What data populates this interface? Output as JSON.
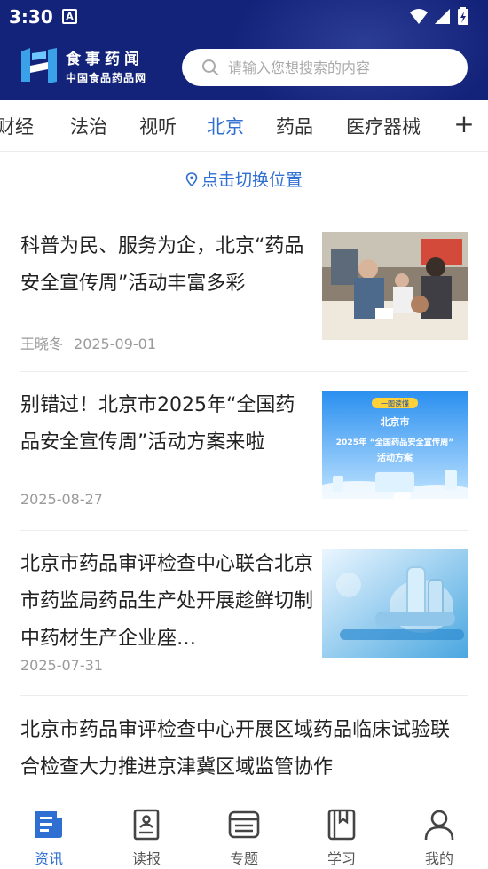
{
  "status_bar": {
    "time": "3:30",
    "notification_glyph": "A"
  },
  "brand": {
    "name": "食事药闻",
    "subtitle": "中国食品药品网"
  },
  "search": {
    "placeholder": "请输入您想搜索的内容"
  },
  "tabs": [
    {
      "label": "财经",
      "active": false
    },
    {
      "label": "法治",
      "active": false
    },
    {
      "label": "视听",
      "active": false
    },
    {
      "label": "北京",
      "active": true
    },
    {
      "label": "药品",
      "active": false
    },
    {
      "label": "医疗器械",
      "active": false
    }
  ],
  "tab_add_label": "+",
  "location": {
    "label": "点击切换位置"
  },
  "news": [
    {
      "title": "科普为民、服务为企，北京“药品安全宣传周”活动丰富多彩",
      "author": "王晓冬",
      "date": "2025-09-01",
      "thumb": "photo-event"
    },
    {
      "title": "别错过！北京市2025年“全国药品安全宣传周”活动方案来啦",
      "author": "",
      "date": "2025-08-27",
      "thumb": "banner",
      "thumb_text": {
        "tag": "一图读懂",
        "line1": "北京市",
        "line2": "2025年 “全国药品安全宣传周”",
        "line3": "活动方案"
      }
    },
    {
      "title": "北京市药品审评检查中心联合北京市药监局药品生产处开展趁鲜切制中药材生产企业座…",
      "author": "",
      "date": "2025-07-31",
      "thumb": "lab-equipment"
    },
    {
      "title": "北京市药品审评检查中心开展区域药品临床试验联合检查大力推进京津冀区域监管协作",
      "author": "",
      "date": "",
      "thumb": ""
    }
  ],
  "bottom_nav": [
    {
      "label": "资讯",
      "icon": "news-icon",
      "active": true
    },
    {
      "label": "读报",
      "icon": "newspaper-icon",
      "active": false
    },
    {
      "label": "专题",
      "icon": "topic-icon",
      "active": false
    },
    {
      "label": "学习",
      "icon": "book-icon",
      "active": false
    },
    {
      "label": "我的",
      "icon": "profile-icon",
      "active": false
    }
  ],
  "colors": {
    "header_bg": "#14237a",
    "accent": "#2f6fd1",
    "text": "#222222",
    "meta": "#9a9a9a"
  }
}
